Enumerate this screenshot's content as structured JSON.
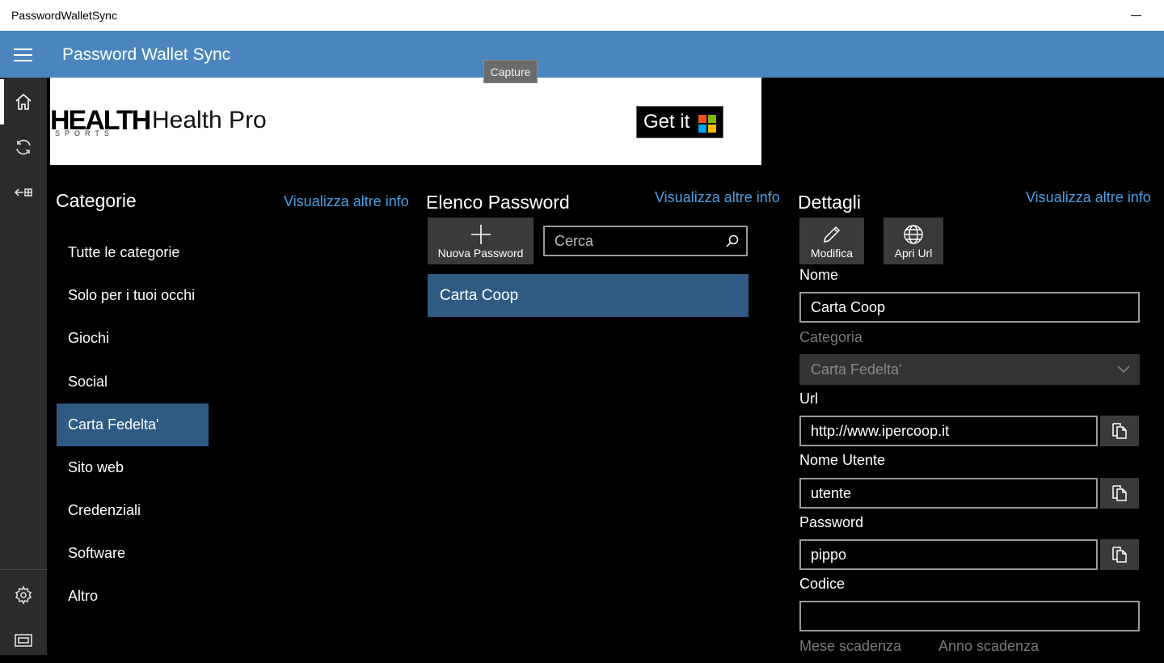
{
  "window": {
    "title": "PasswordWalletSync"
  },
  "header": {
    "title": "Password Wallet Sync"
  },
  "tooltip": {
    "text": "Capture"
  },
  "ad": {
    "logo_main": "HEALTH",
    "logo_sub": "SPORTS",
    "title": "Health Pro",
    "cta": "Get it"
  },
  "categories": {
    "title": "Categorie",
    "more_link": "Visualizza altre info",
    "items": [
      {
        "label": "Tutte le categorie"
      },
      {
        "label": "Solo per i tuoi occhi"
      },
      {
        "label": "Giochi"
      },
      {
        "label": "Social"
      },
      {
        "label": "Carta Fedelta'"
      },
      {
        "label": "Sito web"
      },
      {
        "label": "Credenziali"
      },
      {
        "label": "Software"
      },
      {
        "label": "Altro"
      }
    ],
    "selected": "Carta Fedelta'"
  },
  "passwords": {
    "title": "Elenco Password",
    "more_link": "Visualizza altre info",
    "new_button": "Nuova Password",
    "search_placeholder": "Cerca",
    "items": [
      {
        "label": "Carta Coop"
      }
    ]
  },
  "details": {
    "title": "Dettagli",
    "more_link": "Visualizza altre info",
    "edit_button": "Modifica",
    "open_url_button": "Apri Url",
    "name_label": "Nome",
    "name_value": "Carta Coop",
    "category_label": "Categoria",
    "category_value": "Carta Fedelta'",
    "url_label": "Url",
    "url_value": "http://www.ipercoop.it",
    "username_label": "Nome Utente",
    "username_value": "utente",
    "password_label": "Password",
    "password_value": "pippo",
    "code_label": "Codice",
    "code_value": "",
    "expiry_month_label": "Mese scadenza",
    "expiry_year_label": "Anno scadenza"
  },
  "colors": {
    "accent": "#4a86bd",
    "selection": "#2f5a82",
    "link": "#4aa0e6"
  }
}
